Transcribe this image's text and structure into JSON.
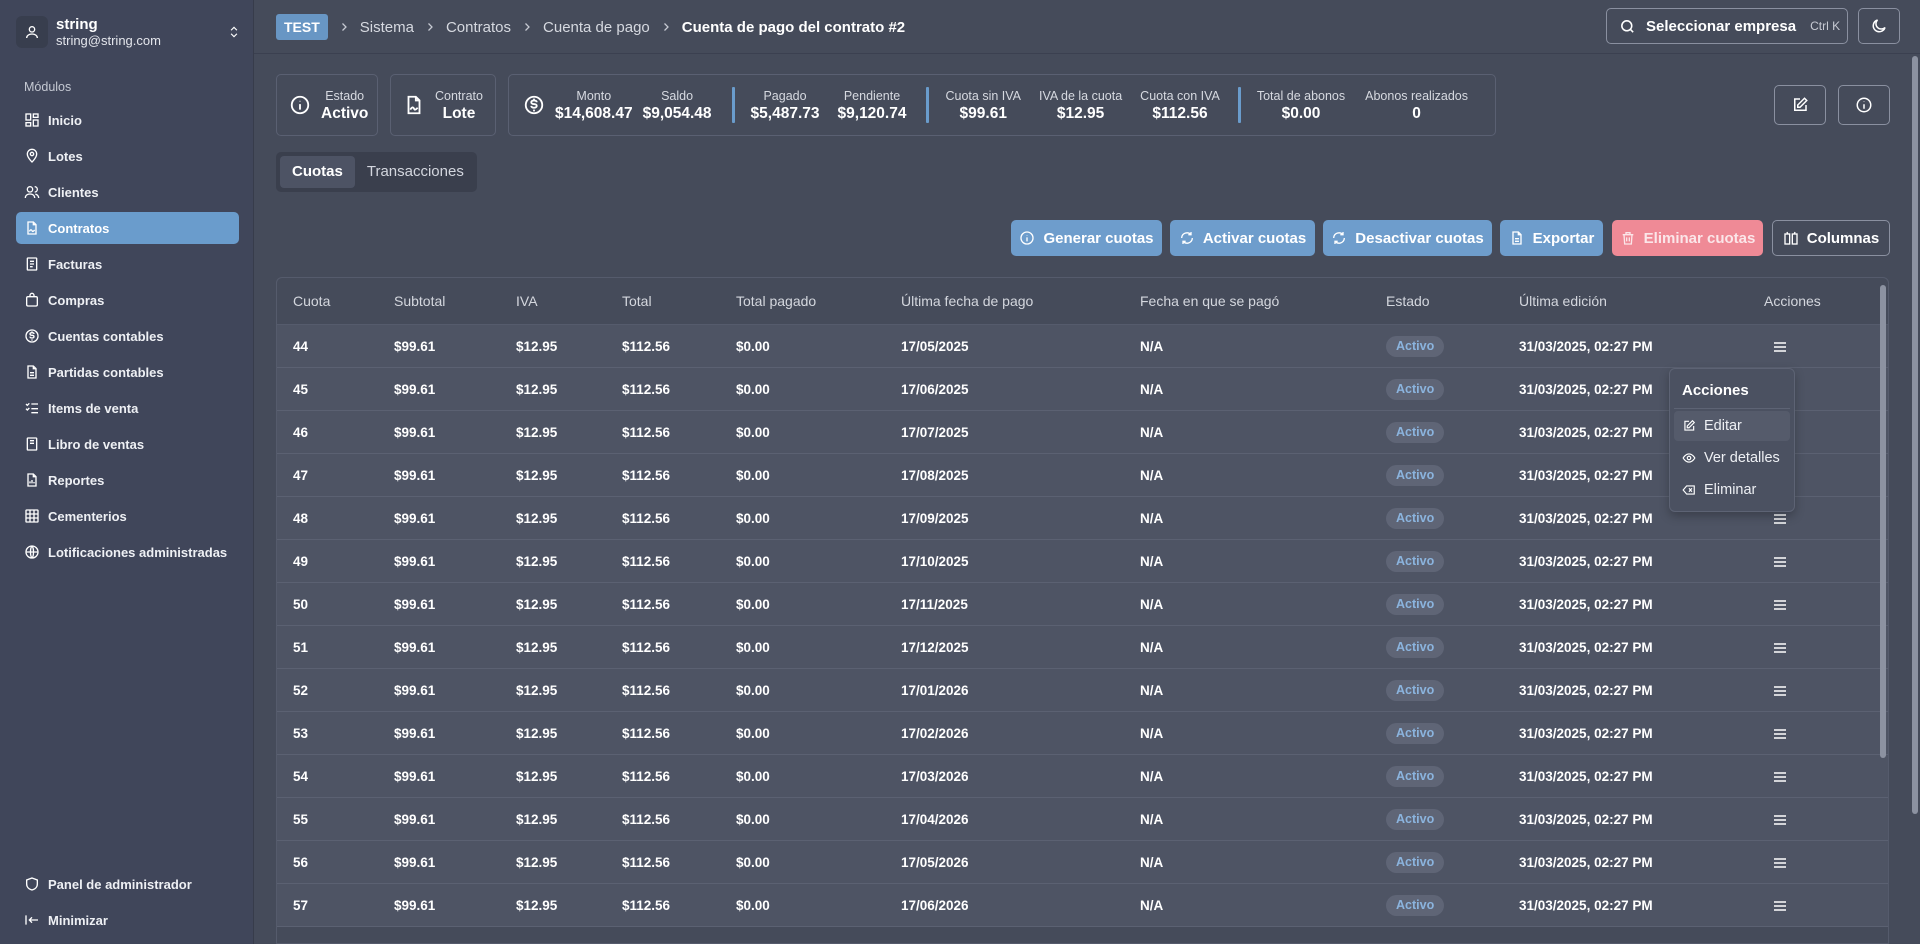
{
  "user": {
    "name": "string",
    "email": "string@string.com"
  },
  "sidebar": {
    "section_label": "Módulos",
    "items": [
      {
        "label": "Inicio",
        "icon": "dashboard-icon"
      },
      {
        "label": "Lotes",
        "icon": "map-pin-icon"
      },
      {
        "label": "Clientes",
        "icon": "users-icon"
      },
      {
        "label": "Contratos",
        "icon": "contract-icon",
        "active": true
      },
      {
        "label": "Facturas",
        "icon": "invoice-icon"
      },
      {
        "label": "Compras",
        "icon": "shopping-bag-icon"
      },
      {
        "label": "Cuentas contables",
        "icon": "dollar-circle-icon"
      },
      {
        "label": "Partidas contables",
        "icon": "file-icon"
      },
      {
        "label": "Items de venta",
        "icon": "list-check-icon"
      },
      {
        "label": "Libro de ventas",
        "icon": "book-icon"
      },
      {
        "label": "Reportes",
        "icon": "report-icon"
      },
      {
        "label": "Cementerios",
        "icon": "grid-icon"
      },
      {
        "label": "Lotificaciones administradas",
        "icon": "globe-icon"
      }
    ],
    "bottom": [
      {
        "label": "Panel de administrador",
        "icon": "shield-icon"
      },
      {
        "label": "Minimizar",
        "icon": "collapse-icon"
      }
    ]
  },
  "header": {
    "env": "TEST",
    "breadcrumbs": [
      "Sistema",
      "Contratos",
      "Cuenta de pago",
      "Cuenta de pago del contrato #2"
    ],
    "company_button": "Seleccionar empresa",
    "shortcut": "Ctrl K"
  },
  "stats": {
    "estado": {
      "label": "Estado",
      "value": "Activo"
    },
    "contrato": {
      "label": "Contrato",
      "value": "Lote"
    },
    "monto": {
      "label": "Monto",
      "value": "$14,608.47"
    },
    "saldo": {
      "label": "Saldo",
      "value": "$9,054.48"
    },
    "pagado": {
      "label": "Pagado",
      "value": "$5,487.73"
    },
    "pendiente": {
      "label": "Pendiente",
      "value": "$9,120.74"
    },
    "cuota_sin_iva": {
      "label": "Cuota sin IVA",
      "value": "$99.61"
    },
    "iva_cuota": {
      "label": "IVA de la cuota",
      "value": "$12.95"
    },
    "cuota_con_iva": {
      "label": "Cuota con IVA",
      "value": "$112.56"
    },
    "total_abonos": {
      "label": "Total de abonos",
      "value": "$0.00"
    },
    "abonos_realizados": {
      "label": "Abonos realizados",
      "value": "0"
    }
  },
  "tabs": [
    "Cuotas",
    "Transacciones"
  ],
  "actions": {
    "generar": "Generar cuotas",
    "activar": "Activar cuotas",
    "desactivar": "Desactivar cuotas",
    "exportar": "Exportar",
    "eliminar": "Eliminar cuotas",
    "columnas": "Columnas"
  },
  "table": {
    "columns": [
      "Cuota",
      "Subtotal",
      "IVA",
      "Total",
      "Total pagado",
      "Última fecha de pago",
      "Fecha en que se pagó",
      "Estado",
      "Última edición",
      "Acciones"
    ],
    "rows": [
      [
        "44",
        "$99.61",
        "$12.95",
        "$112.56",
        "$0.00",
        "17/05/2025",
        "N/A",
        "Activo",
        "31/03/2025, 02:27 PM"
      ],
      [
        "45",
        "$99.61",
        "$12.95",
        "$112.56",
        "$0.00",
        "17/06/2025",
        "N/A",
        "Activo",
        "31/03/2025, 02:27 PM"
      ],
      [
        "46",
        "$99.61",
        "$12.95",
        "$112.56",
        "$0.00",
        "17/07/2025",
        "N/A",
        "Activo",
        "31/03/2025, 02:27 PM"
      ],
      [
        "47",
        "$99.61",
        "$12.95",
        "$112.56",
        "$0.00",
        "17/08/2025",
        "N/A",
        "Activo",
        "31/03/2025, 02:27 PM"
      ],
      [
        "48",
        "$99.61",
        "$12.95",
        "$112.56",
        "$0.00",
        "17/09/2025",
        "N/A",
        "Activo",
        "31/03/2025, 02:27 PM"
      ],
      [
        "49",
        "$99.61",
        "$12.95",
        "$112.56",
        "$0.00",
        "17/10/2025",
        "N/A",
        "Activo",
        "31/03/2025, 02:27 PM"
      ],
      [
        "50",
        "$99.61",
        "$12.95",
        "$112.56",
        "$0.00",
        "17/11/2025",
        "N/A",
        "Activo",
        "31/03/2025, 02:27 PM"
      ],
      [
        "51",
        "$99.61",
        "$12.95",
        "$112.56",
        "$0.00",
        "17/12/2025",
        "N/A",
        "Activo",
        "31/03/2025, 02:27 PM"
      ],
      [
        "52",
        "$99.61",
        "$12.95",
        "$112.56",
        "$0.00",
        "17/01/2026",
        "N/A",
        "Activo",
        "31/03/2025, 02:27 PM"
      ],
      [
        "53",
        "$99.61",
        "$12.95",
        "$112.56",
        "$0.00",
        "17/02/2026",
        "N/A",
        "Activo",
        "31/03/2025, 02:27 PM"
      ],
      [
        "54",
        "$99.61",
        "$12.95",
        "$112.56",
        "$0.00",
        "17/03/2026",
        "N/A",
        "Activo",
        "31/03/2025, 02:27 PM"
      ],
      [
        "55",
        "$99.61",
        "$12.95",
        "$112.56",
        "$0.00",
        "17/04/2026",
        "N/A",
        "Activo",
        "31/03/2025, 02:27 PM"
      ],
      [
        "56",
        "$99.61",
        "$12.95",
        "$112.56",
        "$0.00",
        "17/05/2026",
        "N/A",
        "Activo",
        "31/03/2025, 02:27 PM"
      ],
      [
        "57",
        "$99.61",
        "$12.95",
        "$112.56",
        "$0.00",
        "17/06/2026",
        "N/A",
        "Activo",
        "31/03/2025, 02:27 PM"
      ]
    ]
  },
  "row_menu": {
    "title": "Acciones",
    "items": [
      "Editar",
      "Ver detalles",
      "Eliminar"
    ]
  },
  "colors": {
    "accent": "#6a9ccc",
    "danger": "#ef8a96",
    "background": "#454b5a",
    "sidebar": "#40465a"
  }
}
